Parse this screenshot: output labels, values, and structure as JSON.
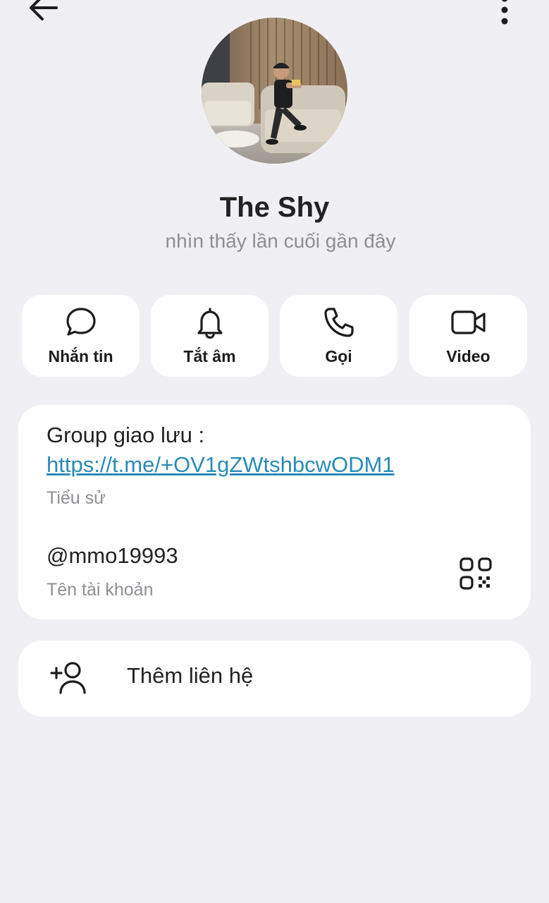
{
  "header": {
    "back_icon": "arrow-left-icon",
    "more_icon": "more-vertical-icon"
  },
  "profile": {
    "name": "The Shy",
    "status": "nhìn thấy lần cuối gần đây"
  },
  "actions": [
    {
      "label": "Nhắn tin",
      "icon": "message-bubble-icon"
    },
    {
      "label": "Tắt âm",
      "icon": "bell-icon"
    },
    {
      "label": "Gọi",
      "icon": "phone-icon"
    },
    {
      "label": "Video",
      "icon": "video-camera-icon"
    }
  ],
  "info": {
    "bio_text": "Group giao lưu :",
    "bio_link": "https://t.me/+OV1gZWtshbcwODM1",
    "bio_label": "Tiểu sử",
    "username": "@mmo19993",
    "username_label": "Tên tài khoản",
    "qr_icon": "qr-code-icon"
  },
  "add_contact": {
    "label": "Thêm liên hệ",
    "icon": "add-person-icon"
  },
  "colors": {
    "background": "#f0f0f4",
    "card": "#ffffff",
    "link": "#2a8bb7",
    "secondary_text": "#8e8e93"
  }
}
